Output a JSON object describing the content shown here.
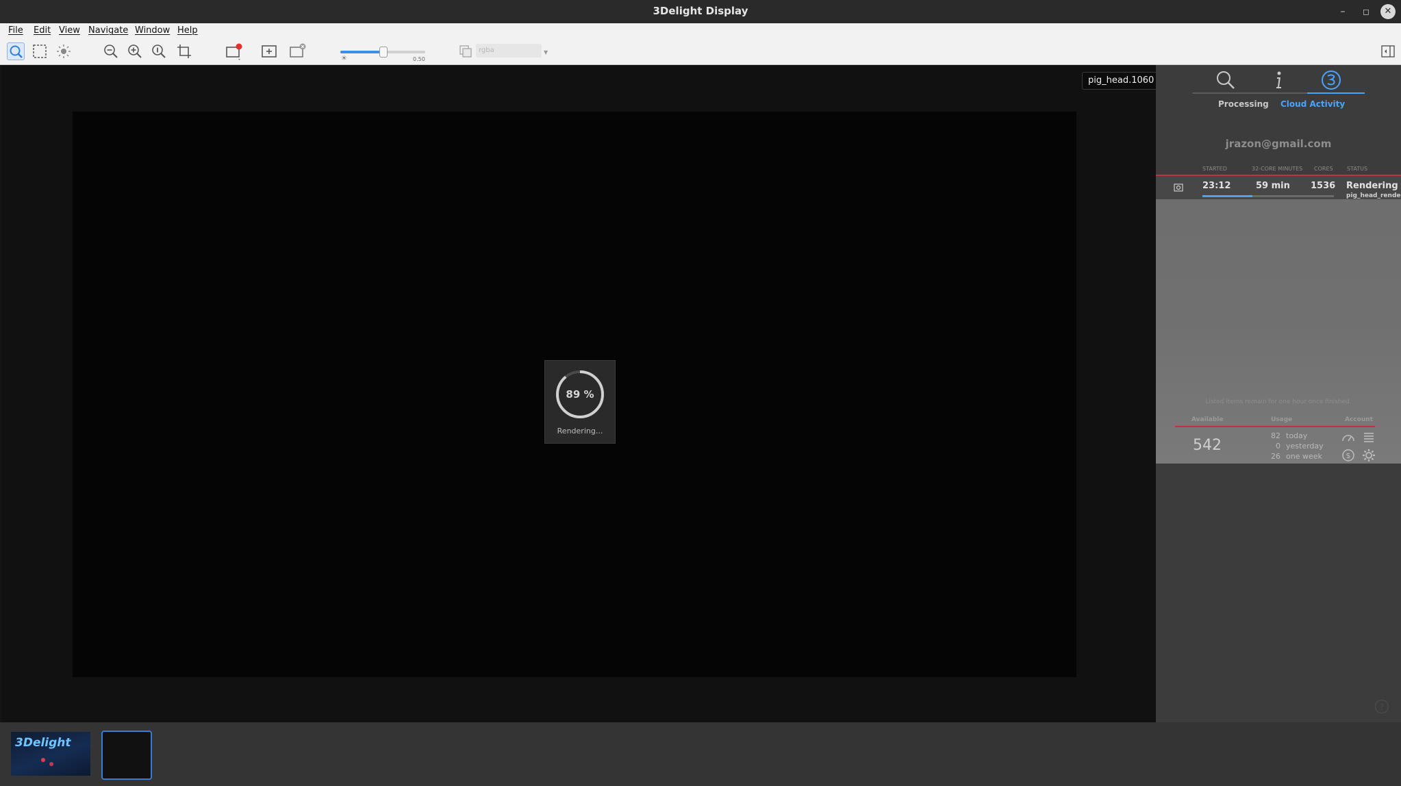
{
  "window": {
    "title": "3Delight Display"
  },
  "menu": {
    "file": "File",
    "edit": "Edit",
    "view": "View",
    "navigate": "Navigate",
    "window": "Window",
    "help": "Help"
  },
  "toolbar": {
    "exposure_value": "0.50",
    "exposure_fraction": 0.5,
    "layer_placeholder": "rgba"
  },
  "viewport": {
    "image_name": "pig_head.1060",
    "progress_percent": "89 %",
    "progress_fraction": 0.89,
    "progress_label": "Rendering..."
  },
  "panel": {
    "tabs": {
      "processing": "Processing",
      "cloud_activity": "Cloud Activity"
    },
    "email": "jrazon@gmail.com",
    "jobs_header": {
      "started": "STARTED",
      "core_minutes": "32-CORE MINUTES",
      "cores": "CORES",
      "status": "STATUS"
    },
    "job": {
      "started": "23:12",
      "core_minutes": "59 min",
      "cores": "1536",
      "status": "Rendering",
      "name": "pig_head_rende",
      "progress_fraction": 0.38
    },
    "jobs_footer": "Listed items remain for one hour once finished.",
    "account_header": {
      "available": "Available",
      "usage": "Usage",
      "account": "Account"
    },
    "available": "542",
    "usage": [
      {
        "value": "82",
        "label": "today"
      },
      {
        "value": "0",
        "label": "yesterday"
      },
      {
        "value": "26",
        "label": "one week"
      }
    ]
  },
  "thumbnails": {
    "logo_text": "3Delight"
  },
  "colors": {
    "accent": "#4aa3ff",
    "red_line": "#c2323c"
  }
}
